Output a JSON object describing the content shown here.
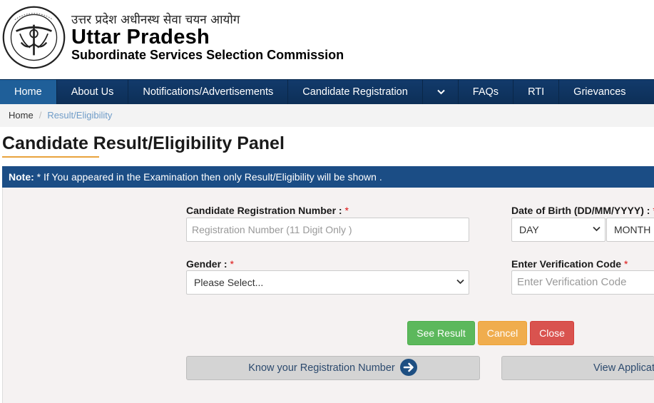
{
  "header": {
    "hindi_title": "उत्तर प्रदेश अधीनस्थ सेवा चयन आयोग",
    "main_title": "Uttar Pradesh",
    "sub_title": "Subordinate Services Selection Commission",
    "logo_icon": "upsssc-emblem-icon"
  },
  "nav": {
    "items": [
      {
        "label": "Home",
        "active": true
      },
      {
        "label": "About Us"
      },
      {
        "label": "Notifications/Advertisements"
      },
      {
        "label": "Candidate Registration"
      },
      {
        "label": "FAQs"
      },
      {
        "label": "RTI"
      },
      {
        "label": "Grievances"
      }
    ],
    "bg_color": "#123a6b",
    "active_color": "#1f5f99"
  },
  "breadcrumb": {
    "home": "Home",
    "separator": "/",
    "current": "Result/Eligibility"
  },
  "page": {
    "title": "Candidate Result/Eligibility Panel",
    "note_label": "Note:",
    "note_text": " * If You appeared in the Examination then only Result/Eligibility will be shown ."
  },
  "form": {
    "reg_label": "Candidate Registration Number : ",
    "reg_placeholder": "Registration Number (11 Digit Only )",
    "dob_label": "Date of Birth (DD/MM/YYYY) : ",
    "dob_day": "DAY",
    "dob_month": "MONTH",
    "gender_label": "Gender : ",
    "gender_value": "Please Select...",
    "verify_label": "Enter Verification Code ",
    "verify_placeholder": "Enter Verification Code",
    "required_mark": "*"
  },
  "buttons": {
    "see_result": "See Result",
    "cancel": "Cancel",
    "close": "Close",
    "know_reg": "Know your Registration Number",
    "view_app": "View Applicati"
  },
  "colors": {
    "accent_underline": "#e8a33d",
    "note_bg": "#1b4d85",
    "green": "#5cb85c",
    "orange": "#f0ad4e",
    "red": "#d9534f"
  }
}
